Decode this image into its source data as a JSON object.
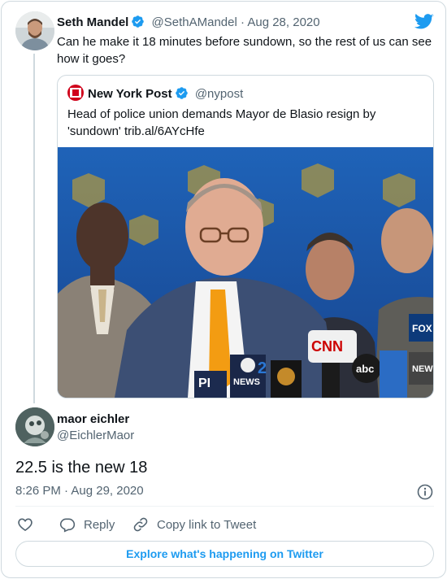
{
  "parent_tweet": {
    "author_name": "Seth Mandel",
    "author_handle": "@SethAMandel",
    "separator": "·",
    "date": "Aug 28, 2020",
    "text": "Can he make it 18 minutes before sundown, so the rest of us can see how it goes?"
  },
  "quoted_tweet": {
    "author_name": "New York Post",
    "author_handle": "@nypost",
    "text": "Head of police union demands Mayor de Blasio resign by 'sundown' trib.al/6AYcHfe",
    "media_texts": {
      "mic_pi": "PI",
      "mic_news2": "2",
      "mic_news2_label": "NEWS",
      "mic_cnn": "CNN",
      "mic_abc": "abc",
      "mic_fox": "FOX",
      "mic_news": "NEW"
    }
  },
  "reply_tweet": {
    "author_name": "maor eichler",
    "author_handle": "@EichlerMaor",
    "text": "22.5 is the new 18",
    "time": "8:26 PM · Aug 29, 2020"
  },
  "actions": {
    "reply_label": "Reply",
    "copy_label": "Copy link to Tweet"
  },
  "explore_label": "Explore what's happening on Twitter",
  "colors": {
    "accent": "#1d9bf0",
    "text_primary": "#0f1419",
    "text_secondary": "#536471",
    "border": "#cfd9de"
  }
}
